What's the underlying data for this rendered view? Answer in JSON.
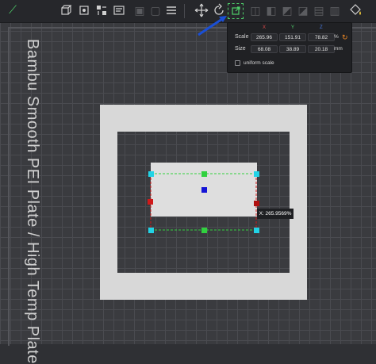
{
  "toolbar": {
    "buttons": [
      {
        "name": "add-icon"
      },
      {
        "name": "orient-icon"
      },
      {
        "name": "auto-arrange-icon"
      },
      {
        "name": "plate-settings-icon"
      },
      {
        "name": "layers-menu-icon"
      },
      {
        "name": "move-icon"
      },
      {
        "name": "rotate-icon"
      },
      {
        "name": "scale-icon"
      },
      {
        "name": "paint-icon"
      }
    ]
  },
  "plate_label": "Bambu Smooth PEI Plate / High Temp Plate",
  "scale_panel": {
    "axis_x": "X",
    "axis_y": "Y",
    "axis_z": "Z",
    "scale_label": "Scale",
    "scale_x": "265.96",
    "scale_y": "151.91",
    "scale_z": "78.82",
    "scale_unit": "%",
    "size_label": "Size",
    "size_x": "68.08",
    "size_y": "38.89",
    "size_z": "20.18",
    "size_unit": "mm",
    "uniform_label": "uniform scale",
    "uniform_checked": false
  },
  "tooltip": "X: 265.9569%",
  "colors": {
    "annotation_arrow": "#1a4fd6",
    "handle_cyan": "#22d3e6",
    "handle_green": "#31d13f",
    "handle_red": "#d11a1a",
    "handle_blue": "#1414d6",
    "reset_icon": "#f08a24"
  }
}
